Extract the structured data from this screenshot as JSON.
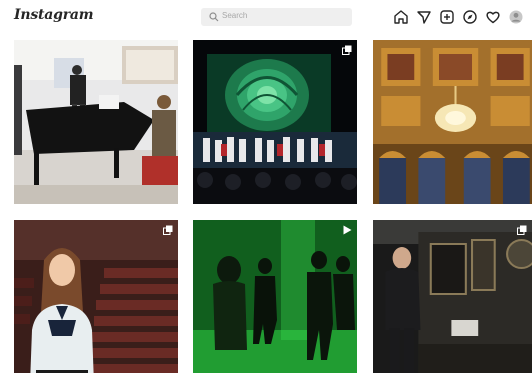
{
  "app": {
    "logo": "Instagram"
  },
  "search": {
    "placeholder": "Search",
    "icon": "search-icon"
  },
  "nav": {
    "icons": [
      "home-icon",
      "direct-message-icon",
      "new-post-icon",
      "explore-icon",
      "activity-heart-icon",
      "profile-avatar"
    ]
  },
  "posts": [
    {
      "subject": "grand piano rehearsal room",
      "badge": ""
    },
    {
      "subject": "stage with glowing green rose projection",
      "badge": "multiple-photos-icon"
    },
    {
      "subject": "ornate gilded ceiling with chandelier",
      "badge": ""
    },
    {
      "subject": "woman in auditorium seats",
      "badge": "multiple-photos-icon"
    },
    {
      "subject": "people walking in green light",
      "badge": "video-icon"
    },
    {
      "subject": "man on historic railway carriage",
      "badge": "multiple-photos-icon"
    }
  ],
  "colors": {
    "text": "#262626",
    "search_bg": "#efefef",
    "placeholder": "#a8a8a8"
  }
}
